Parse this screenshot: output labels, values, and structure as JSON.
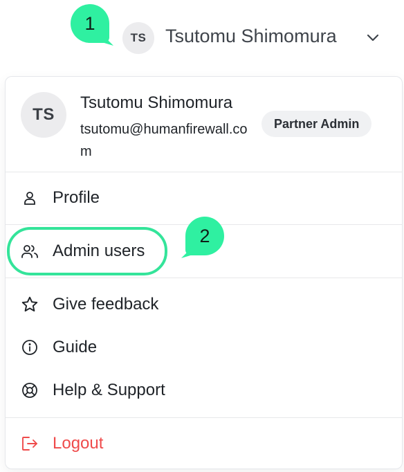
{
  "topbar": {
    "avatar_initials": "TS",
    "user_name": "Tsutomu Shimomura"
  },
  "annotations": {
    "marker_1": "1",
    "marker_2": "2"
  },
  "menu": {
    "header": {
      "avatar_initials": "TS",
      "name": "Tsutomu Shimomura",
      "email": "tsutomu@humanfirewall.com",
      "role_badge": "Partner Admin"
    },
    "items": [
      {
        "label": "Profile",
        "icon": "user-icon"
      },
      {
        "label": "Admin users",
        "icon": "users-icon"
      },
      {
        "label": "Give feedback",
        "icon": "star-icon"
      },
      {
        "label": "Guide",
        "icon": "info-circle-icon"
      },
      {
        "label": "Help & Support",
        "icon": "lifebuoy-icon"
      },
      {
        "label": "Logout",
        "icon": "logout-icon"
      }
    ]
  },
  "colors": {
    "accent_highlight": "#34e49a",
    "annotation_bubble": "#2ff0a1",
    "logout": "#ef4b4b",
    "avatar_bg": "#ececee",
    "badge_bg": "#f0f1f3"
  }
}
